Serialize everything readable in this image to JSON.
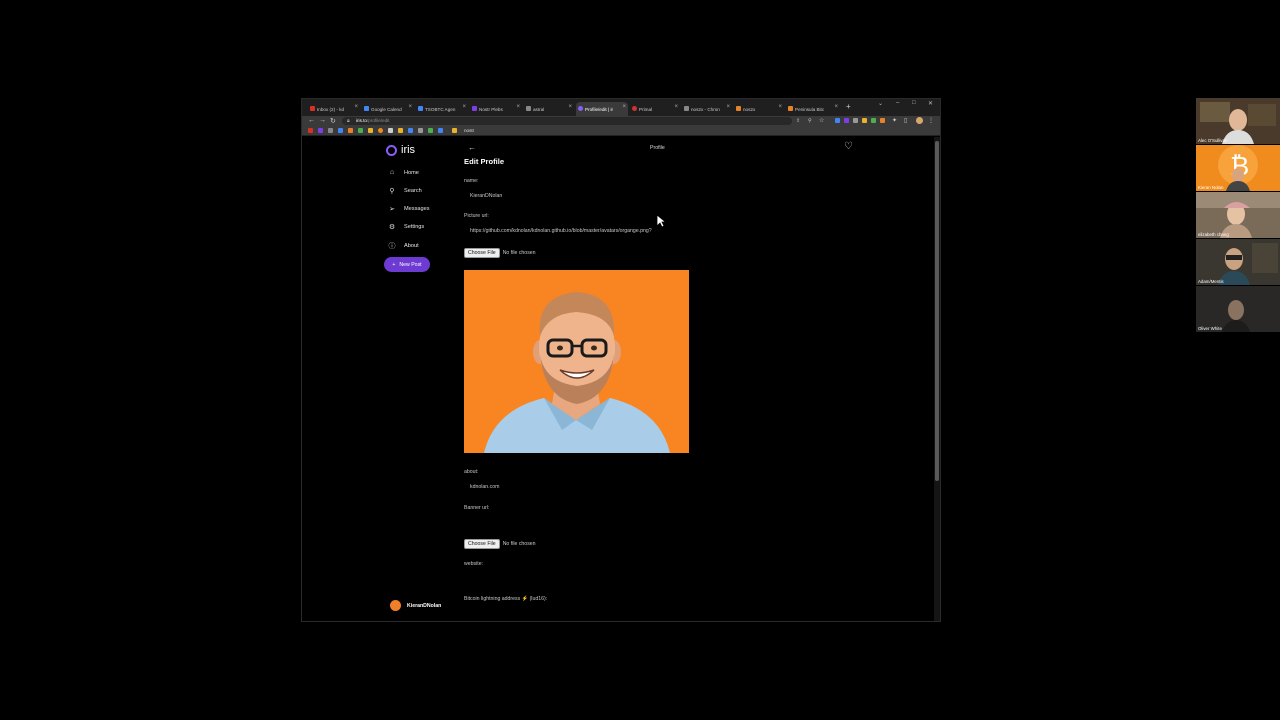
{
  "browser": {
    "tabs": [
      {
        "label": "Inbox (2) - kd",
        "color": "#d93025"
      },
      {
        "label": "Google Calend",
        "color": "#4285f4"
      },
      {
        "label": "TSOBTC Agen",
        "color": "#4285f4"
      },
      {
        "label": "Nostr Plebs",
        "color": "#7b3fe4"
      },
      {
        "label": "astral",
        "color": "#888888"
      },
      {
        "label": "Profile/edit | ir",
        "color": "#8b5cf6"
      },
      {
        "label": "Primal",
        "color": "#cc3333"
      },
      {
        "label": "nos2x - Chron",
        "color": "#888888"
      },
      {
        "label": "nos2x",
        "color": "#e8812b"
      },
      {
        "label": "Peninsula Bitc",
        "color": "#e8812b"
      }
    ],
    "url_host": "iris.to",
    "url_path": "/profile/edit",
    "bookmark_label": "nostr"
  },
  "sidebar": {
    "brand": "iris",
    "items": [
      {
        "label": "Home",
        "icon": "home-icon",
        "glyph": "⌂"
      },
      {
        "label": "Search",
        "icon": "search-icon",
        "glyph": "⚲"
      },
      {
        "label": "Messages",
        "icon": "send-icon",
        "glyph": "➢"
      },
      {
        "label": "Settings",
        "icon": "gear-icon",
        "glyph": "⚙"
      },
      {
        "label": "About",
        "icon": "info-icon",
        "glyph": "ⓘ"
      }
    ],
    "new_post_label": "New Post",
    "user_name": "KieranDNolan"
  },
  "header": {
    "page_title": "Profile",
    "title": "Edit Profile"
  },
  "form": {
    "name_label": "name:",
    "name_value": "KieranDNolan",
    "picture_label": "Picture url:",
    "picture_value": "https://github.com/kdnolan/kdnolan.github.io/blob/master/avatars/organge.png?",
    "choose_file": "Choose File",
    "no_file": "No file chosen",
    "about_label": "about:",
    "about_value": "kdnolan.com",
    "banner_label": "Banner url:",
    "website_label": "website:",
    "lightning_label": "Bitcoin lightning address ⚡ (lud16):"
  },
  "participants": [
    {
      "name": "Alec O'Sullivan",
      "bg": "#4a3a2c"
    },
    {
      "name": "Kieran Nolan",
      "bg": "#f08c1e"
    },
    {
      "name": "elizabeth chang",
      "bg": "#7a6a58"
    },
    {
      "name": "Adam/Mentis",
      "bg": "#3a3630"
    },
    {
      "name": "Oliver White",
      "bg": "#2a2826"
    }
  ]
}
